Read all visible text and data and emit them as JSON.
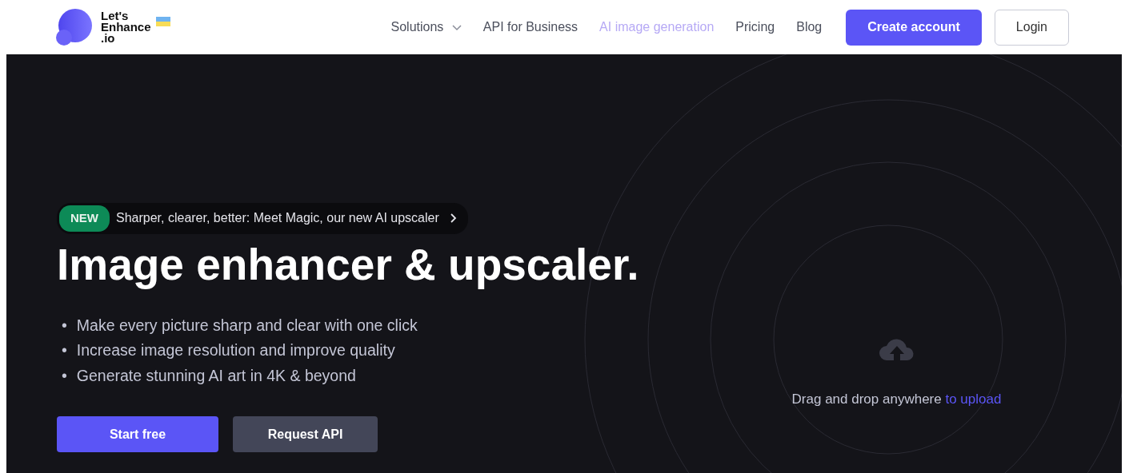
{
  "logo": {
    "lines": [
      "Let's",
      "Enhance",
      ".io"
    ]
  },
  "nav": {
    "items": [
      {
        "label": "Solutions",
        "dropdown": true,
        "selected": false
      },
      {
        "label": "API for Business",
        "dropdown": false,
        "selected": false
      },
      {
        "label": "AI image generation",
        "dropdown": false,
        "selected": true
      },
      {
        "label": "Pricing",
        "dropdown": false,
        "selected": false
      },
      {
        "label": "Blog",
        "dropdown": false,
        "selected": false
      }
    ],
    "buttons": [
      {
        "label": "Create account",
        "kind": "primary"
      },
      {
        "label": "Login",
        "kind": "outline"
      }
    ]
  },
  "announcement": {
    "badge": "NEW",
    "text": "Sharper, clearer, better: Meet Magic, our new AI upscaler"
  },
  "hero": {
    "title": "Image enhancer & upscaler.",
    "bullets": [
      {
        "marker": "•",
        "text": "Make every picture sharp and clear with one click"
      },
      {
        "marker": "•",
        "text": "Increase image resolution and improve quality"
      },
      {
        "marker": "•",
        "text": "Generate stunning AI art in 4K & beyond"
      }
    ],
    "buttons": [
      {
        "label": "Start free",
        "kind": "primary"
      },
      {
        "label": "Request API",
        "kind": "secondary"
      }
    ]
  },
  "upload": {
    "text": "Drag and drop anywhere",
    "link": "to upload"
  }
}
